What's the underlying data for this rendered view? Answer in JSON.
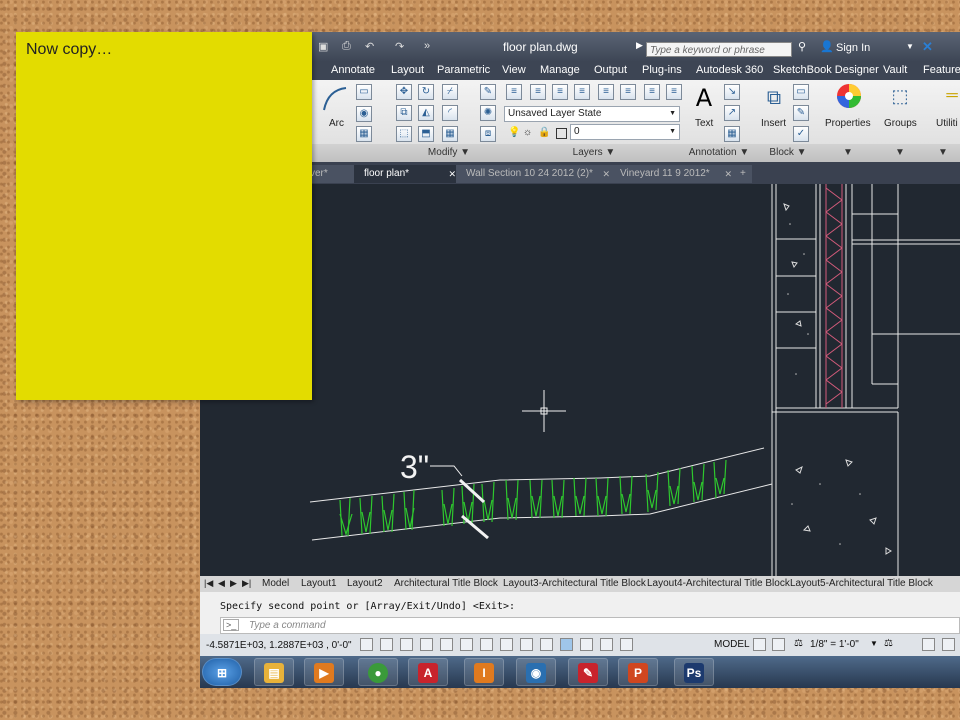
{
  "slide": {
    "note_text": "Now copy…"
  },
  "window": {
    "title": "floor plan.dwg",
    "search_placeholder": "Type a keyword or phrase",
    "sign_in": "Sign In"
  },
  "ribbon_tabs": [
    "t",
    "Annotate",
    "Layout",
    "Parametric",
    "View",
    "Manage",
    "Output",
    "Plug-ins",
    "Autodesk 360",
    "SketchBook Designer",
    "Vault",
    "Featured"
  ],
  "ribbon": {
    "arc_label": "Arc",
    "modify_label": "Modify",
    "layers_label": "Layers",
    "layer_state": "Unsaved Layer State",
    "layer_current": "0",
    "text_label": "Text",
    "annotation_label": "Annotation",
    "insert_label": "Insert",
    "block_label": "Block",
    "properties_label": "Properties",
    "groups_label": "Groups",
    "utilities_label": "Utiliti"
  },
  "doc_tabs": [
    "ver*",
    "floor plan*",
    "Wall Section 10 24 2012 (2)*",
    "Vineyard 11 9 2012*"
  ],
  "drawing": {
    "dimension_text": "3\""
  },
  "layout_tabs": [
    "Model",
    "Layout1",
    "Layout2",
    "Architectural Title Block",
    "Layout3-Architectural Title Block",
    "Layout4-Architectural Title Block",
    "Layout5-Architectural Title Block"
  ],
  "command": {
    "history": "Specify second point or [Array/Exit/Undo] <Exit>:",
    "placeholder": "Type a command"
  },
  "status": {
    "coords": "-4.5871E+03, 1.2887E+03 , 0'-0\"",
    "model": "MODEL",
    "scale": "1/8\" = 1'-0\""
  },
  "taskbar": [
    {
      "name": "windows-start",
      "glyph": "⊞",
      "color": "#1f7fd6"
    },
    {
      "name": "file-explorer",
      "glyph": "▤",
      "color": "#e8b23a"
    },
    {
      "name": "media-player",
      "glyph": "▶",
      "color": "#e07a1f"
    },
    {
      "name": "chrome",
      "glyph": "●",
      "color": "#3a9a3a"
    },
    {
      "name": "autocad",
      "glyph": "A",
      "color": "#c8232c"
    },
    {
      "name": "inventor",
      "glyph": "I",
      "color": "#e07a1f"
    },
    {
      "name": "viewer",
      "glyph": "◉",
      "color": "#2a6fb0"
    },
    {
      "name": "acrobat",
      "glyph": "✎",
      "color": "#c8232c"
    },
    {
      "name": "powerpoint",
      "glyph": "P",
      "color": "#d0461f"
    },
    {
      "name": "photoshop",
      "glyph": "Ps",
      "color": "#1c3a6e"
    }
  ]
}
